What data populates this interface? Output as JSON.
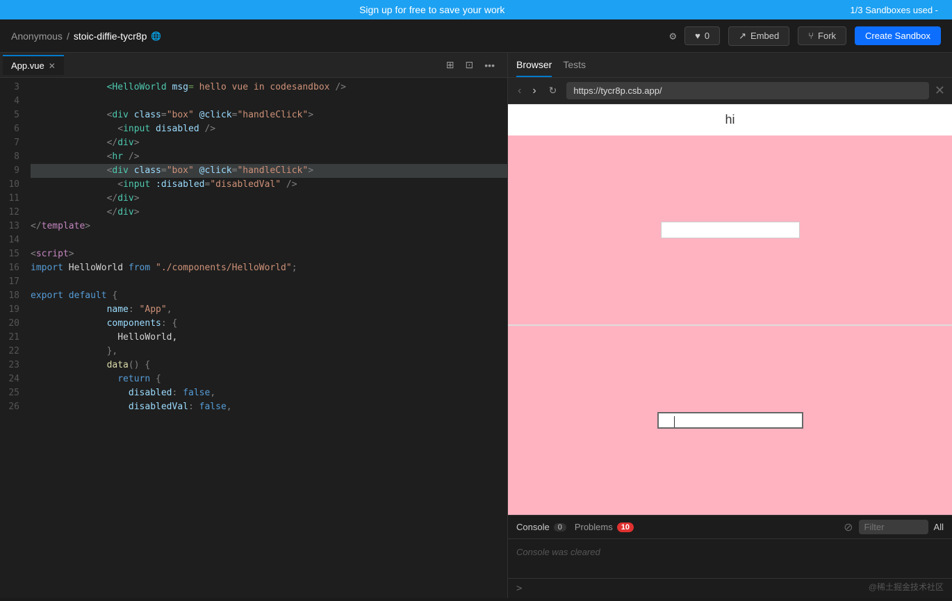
{
  "banner": {
    "text": "Sign up for free to save your work",
    "right": "1/3 Sandboxes used -"
  },
  "header": {
    "user": "Anonymous",
    "separator": "/",
    "project": "stoic-diffie-tycr8p",
    "globe_icon": "🌐",
    "settings_icon": "⚙",
    "likes": "0",
    "embed_label": "Embed",
    "fork_label": "Fork",
    "create_label": "Create Sandbox"
  },
  "editor": {
    "tab_name": "App.vue",
    "lines": [
      {
        "num": 4,
        "content": ""
      },
      {
        "num": 5,
        "html": "<span class='plain'>  </span><span class='punct'>&lt;</span><span class='tag'>div</span> <span class='attr'>class</span><span class='punct'>=</span><span class='str'>\"box\"</span> <span class='attr'>@click</span><span class='punct'>=</span><span class='str'>\"handleClick\"</span><span class='punct'>&gt;</span>"
      },
      {
        "num": 6,
        "html": "<span class='plain'>    </span><span class='punct'>&lt;</span><span class='tag'>input</span> <span class='attr'>disabled</span> <span class='punct'>/&gt;</span>"
      },
      {
        "num": 7,
        "html": "<span class='plain'>  </span><span class='punct'>&lt;/</span><span class='tag'>div</span><span class='punct'>&gt;</span>"
      },
      {
        "num": 8,
        "html": "<span class='plain'>  </span><span class='punct'>&lt;</span><span class='tag'>hr</span> <span class='punct'>/&gt;</span>"
      },
      {
        "num": 9,
        "html": "<span class='plain'>  </span><span class='punct'>&lt;</span><span class='tag'>div</span> <span class='attr'>class</span><span class='punct'>=</span><span class='str'>\"box\"</span> <span class='attr'>@click</span><span class='punct'>=</span><span class='str'>\"handleClick\"</span><span class='punct'>&gt;</span>",
        "selected": true
      },
      {
        "num": 10,
        "html": "<span class='plain'>    </span><span class='punct'>&lt;</span><span class='tag'>input</span> <span class='attr'>:disabled</span><span class='punct'>=</span><span class='str'>\"disabledVal\"</span> <span class='punct'>/&gt;</span>"
      },
      {
        "num": 11,
        "html": "<span class='plain'>  </span><span class='punct'>&lt;/</span><span class='tag'>div</span><span class='punct'>&gt;</span>"
      },
      {
        "num": 12,
        "html": "<span class='plain'>  </span><span class='punct'>&lt;/</span><span class='tag'>div</span><span class='punct'>&gt;</span>"
      },
      {
        "num": 13,
        "html": "<span class='punct'>&lt;/</span><span class='template-tag'>template</span><span class='punct'>&gt;</span>"
      },
      {
        "num": 14,
        "html": ""
      },
      {
        "num": 15,
        "html": "<span class='punct'>&lt;</span><span class='template-tag'>script</span><span class='punct'>&gt;</span>"
      },
      {
        "num": 16,
        "html": "<span class='kw'>import</span> <span class='plain'>HelloWorld</span> <span class='kw'>from</span> <span class='str'>\"./components/HelloWorld\"</span><span class='punct'>;</span>"
      },
      {
        "num": 17,
        "html": ""
      },
      {
        "num": 18,
        "html": "<span class='kw'>export default</span> <span class='punct'>{</span>"
      },
      {
        "num": 19,
        "html": "<span class='plain'>  </span><span class='attr'>name</span><span class='punct'>:</span> <span class='str'>\"App\"</span><span class='punct'>,</span>"
      },
      {
        "num": 20,
        "html": "<span class='plain'>  </span><span class='attr'>components</span><span class='punct'>:</span> <span class='plain'>{</span>"
      },
      {
        "num": 21,
        "html": "<span class='plain'>    HelloWorld,</span>"
      },
      {
        "num": 22,
        "html": "<span class='plain'>  </span><span class='punct'>},</span>"
      },
      {
        "num": 23,
        "html": "<span class='plain'>  </span><span class='fn'>data</span><span class='punct'>() {</span>"
      },
      {
        "num": 24,
        "html": "<span class='plain'>    </span><span class='kw'>return</span> <span class='punct'>{</span>"
      },
      {
        "num": 25,
        "html": "<span class='plain'>      </span><span class='attr'>disabled</span><span class='punct'>:</span> <span class='kw'>false</span><span class='punct'>,</span>"
      },
      {
        "num": 26,
        "html": "<span class='plain'>      </span><span class='attr'>disabledVal</span><span class='punct'>:</span> <span class='kw'>false</span><span class='punct'>,</span>"
      }
    ],
    "hidden_line_before": "<HelloWorld msg= hello vue in codesandbox  />"
  },
  "preview": {
    "url": "https://tycr8p.csb.app/",
    "hi_text": "hi",
    "console_cleared": "Console was cleared"
  },
  "tabs": {
    "browser": "Browser",
    "tests": "Tests"
  },
  "console": {
    "label": "Console",
    "count": "0",
    "problems_label": "Problems",
    "problems_count": "10",
    "filter_placeholder": "Filter",
    "all_label": "All",
    "prompt": ">"
  },
  "watermark": "@稀土掘金技术社区"
}
